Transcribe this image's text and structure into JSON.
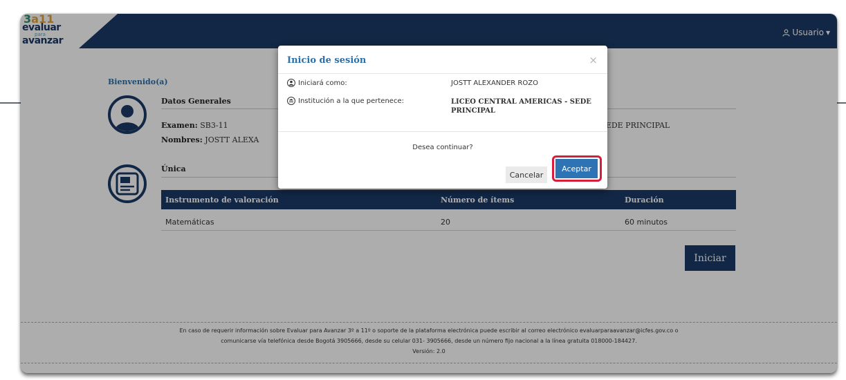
{
  "header": {
    "logo": {
      "line1_three": "3",
      "line1_a": "a",
      "line1_eleven": "11",
      "line2": "evaluar",
      "line3": "para",
      "line4": "avanzar"
    },
    "user_label": "Usuario"
  },
  "welcome": "Bienvenido(a)",
  "general": {
    "title": "Datos Generales",
    "exam_label": "Examen:",
    "exam_value": "SB3-11",
    "names_label": "Nombres:",
    "names_value": "JOSTT ALEXA",
    "institution_partial": "ERICAS - SEDE PRINCIPAL"
  },
  "section2": {
    "title": "Única"
  },
  "table": {
    "headers": [
      "Instrumento de valoración",
      "Número de ítems",
      "Duración"
    ],
    "rows": [
      [
        "Matemáticas",
        "20",
        "60 minutos"
      ]
    ]
  },
  "start_button": "Iniciar",
  "footer": {
    "line1": "En caso de requerir información sobre Evaluar para Avanzar 3º a 11º o soporte de la plataforma electrónica puede escribir al correo electrónico evaluarparaavanzar@icfes.gov.co o",
    "line2": "comunicarse vía telefónica desde Bogotá 3905666, desde su celular 031- 3905666, desde un número fijo nacional a la línea gratuita 018000-184427.",
    "line3": "Versión: 2.0"
  },
  "modal": {
    "title": "Inicio de sesión",
    "close": "×",
    "login_as_label": "Iniciará como:",
    "login_as_value": "JOSTT ALEXANDER ROZO",
    "institution_label": "Institución a la que pertenece:",
    "institution_value": "LICEO CENTRAL AMERICAS - SEDE PRINCIPAL",
    "question": "Desea continuar?",
    "cancel": "Cancelar",
    "accept": "Aceptar"
  },
  "colors": {
    "navy": "#1b3a66",
    "accent_blue": "#2e74b5",
    "highlight_red": "#d61d3c"
  },
  "icons": [
    "user-icon",
    "person-circle-icon",
    "institution-icon",
    "profile-avatar-icon",
    "document-avatar-icon"
  ]
}
